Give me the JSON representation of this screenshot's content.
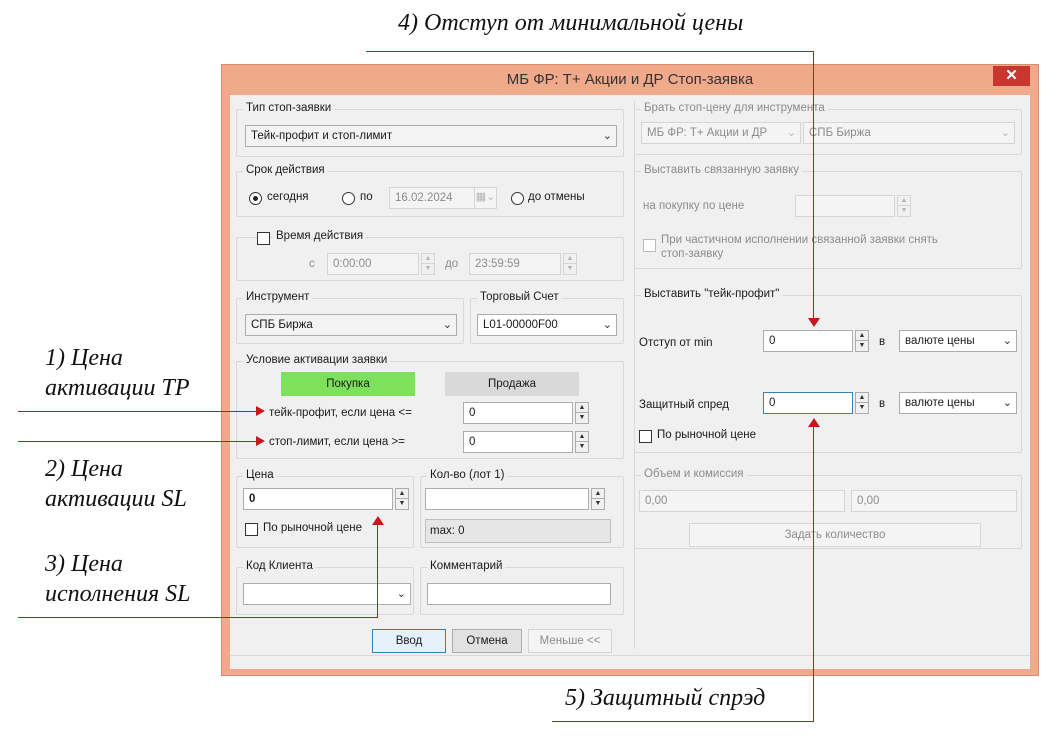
{
  "annotations": {
    "a1": "1) Цена",
    "a1b": "активации TP",
    "a2": "2) Цена",
    "a2b": "активации SL",
    "a3": "3) Цена",
    "a3b": "исполнения SL",
    "a4": "4) Отступ от минимальной цены",
    "a5": "5) Защитный спрэд"
  },
  "window": {
    "title": "МБ ФР: Т+ Акции и ДР Стоп-заявка",
    "close": "✕"
  },
  "left": {
    "stop_type": {
      "legend": "Тип стоп-заявки",
      "value": "Тейк-профит и стоп-лимит"
    },
    "validity": {
      "legend": "Срок действия",
      "today": "сегодня",
      "until": "по",
      "date": "16.02.2024",
      "until_cancel": "до отмены"
    },
    "time": {
      "legend": "Время действия",
      "from_label": "с",
      "from": "0:00:00",
      "to_label": "до",
      "to": "23:59:59"
    },
    "instrument": {
      "legend": "Инструмент",
      "value": "СПБ Биржа"
    },
    "account": {
      "legend": "Торговый Счет",
      "value": "L01-00000F00"
    },
    "activation": {
      "legend": "Условие активации заявки",
      "buy": "Покупка",
      "sell": "Продажа",
      "tp_label": "тейк-профит, если цена <=",
      "tp_value": "0",
      "sl_label": "стоп-лимит, если цена >=",
      "sl_value": "0"
    },
    "price": {
      "legend": "Цена",
      "value": "0",
      "market": "По рыночной цене"
    },
    "qty": {
      "legend": "Кол-во (лот 1)",
      "value": "",
      "max": "max: 0"
    },
    "client": {
      "legend": "Код Клиента",
      "value": ""
    },
    "comment": {
      "legend": "Комментарий",
      "value": ""
    }
  },
  "right": {
    "instrument_price": {
      "legend": "Брать стоп-цену для инструмента",
      "board": "МБ ФР: Т+ Акции и ДР",
      "exchange": "СПБ Биржа"
    },
    "linked": {
      "legend": "Выставить связанную заявку",
      "buy_price_label": "на покупку по цене",
      "buy_price": "",
      "cancel_line1": "При частичном исполнении связанной заявки снять",
      "cancel_line2": "стоп-заявку"
    },
    "takeprofit": {
      "legend": "Выставить \"тейк-профит\"",
      "offset_label": "Отступ от min",
      "offset_value": "0",
      "in1": "в",
      "offset_unit": "валюте цены",
      "spread_label": "Защитный спред",
      "spread_value": "0",
      "in2": "в",
      "spread_unit": "валюте цены",
      "market": "По рыночной цене"
    },
    "volume": {
      "legend": "Объем и комиссия",
      "vol1": "0,00",
      "vol2": "0,00",
      "set_qty": "Задать количество"
    }
  },
  "footer": {
    "enter": "Ввод",
    "cancel": "Отмена",
    "less": "Меньше <<"
  },
  "colors": {
    "window_border": "#f0a98a",
    "arrow": "#c8161d",
    "buy": "#7ee15b",
    "close_button": "#c7372f"
  }
}
